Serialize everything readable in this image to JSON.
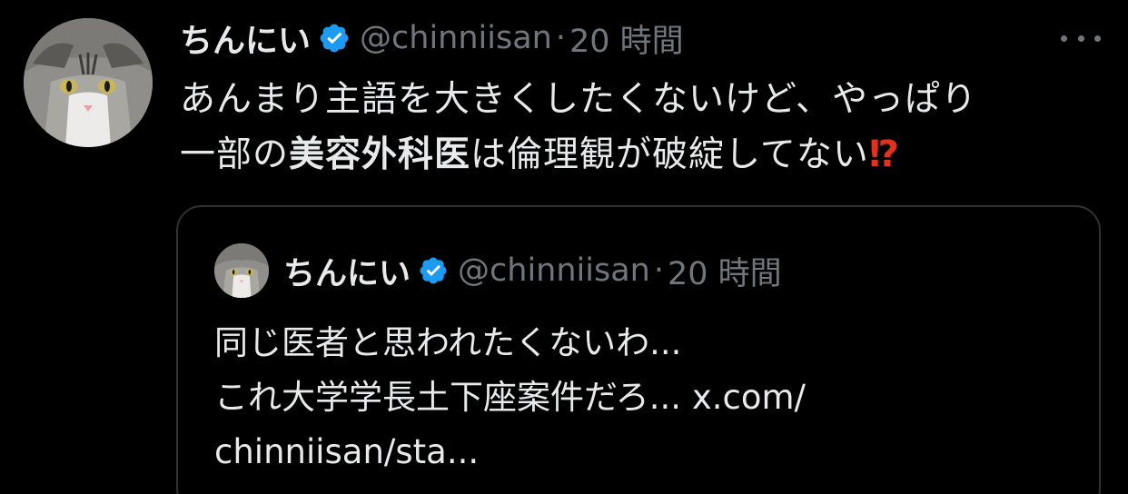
{
  "tweet": {
    "author": {
      "display_name": "ちんにい",
      "handle": "@chinniisan",
      "verified": true
    },
    "separator": "·",
    "time": "20 時間",
    "more_icon": "more-horizontal-icon",
    "text": {
      "line1": "あんまり主語を大きくしたくないけど、やっぱり",
      "line2_pre": "一部の",
      "line2_bold": "美容外科医",
      "line2_post": "は倫理観が破綻してない",
      "line2_emoji": "⁉"
    }
  },
  "quote": {
    "author": {
      "display_name": "ちんにい",
      "handle": "@chinniisan",
      "verified": true
    },
    "separator": "·",
    "time": "20 時間",
    "text": {
      "line1": "同じ医者と思われたくないわ...",
      "line2": "これ大学学長土下座案件だろ... x.com/",
      "line3": "chinniisan/sta..."
    }
  },
  "colors": {
    "background": "#000000",
    "text_primary": "#e7e9ea",
    "text_secondary": "#71767b",
    "verified_badge": "#1d9bf0",
    "border": "#2f3336",
    "emoji_red": "#e0331f"
  }
}
